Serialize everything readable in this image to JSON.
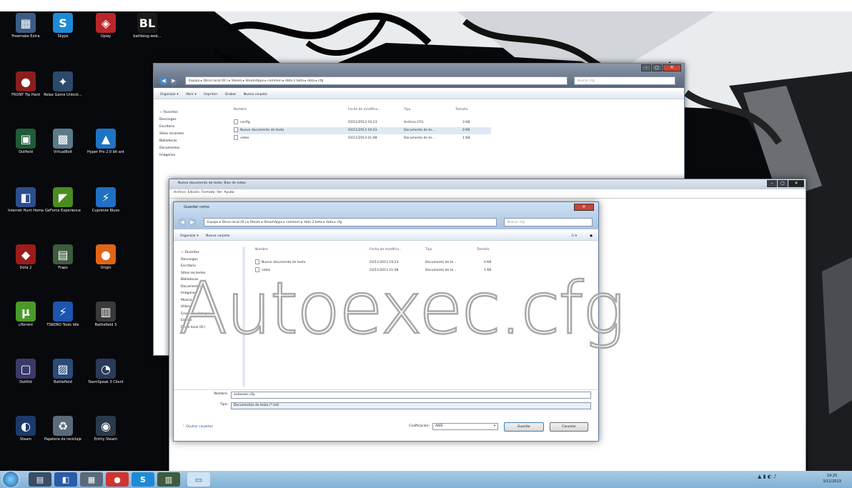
{
  "overlay_text": "Autoexec.cfg",
  "desktop_icons": [
    {
      "label": "Freemake Extra",
      "color": "#3a5d85",
      "glyph": "▦"
    },
    {
      "label": "Skype",
      "color": "#1e8ad6",
      "glyph": "S"
    },
    {
      "label": "Uplay",
      "color": "#b8262a",
      "glyph": "◈"
    },
    {
      "label": "battlelog-web...",
      "color": "#1a1a1a",
      "glyph": "BL"
    },
    {
      "label": "FRONT Tip Hard",
      "color": "#8a1e1e",
      "glyph": "●"
    },
    {
      "label": "Relax Game Unlock...",
      "color": "#2b4a6b",
      "glyph": "✦"
    },
    {
      "label": "Outfield",
      "color": "#1f5c37",
      "glyph": "▣"
    },
    {
      "label": "VirtualBolt",
      "color": "#5a7a8a",
      "glyph": "▩"
    },
    {
      "label": "Hyper Pro 2.0 bit ant",
      "color": "#1e74c4",
      "glyph": "▲"
    },
    {
      "label": "Internet Hunt Home",
      "color": "#2c4f8c",
      "glyph": "◧"
    },
    {
      "label": "GeForce Experience",
      "color": "#4b8b1f",
      "glyph": "◤"
    },
    {
      "label": "Cuprente Blues",
      "color": "#1f6fc2",
      "glyph": "⚡"
    },
    {
      "label": "Dota 2",
      "color": "#9c1c1c",
      "glyph": "◆"
    },
    {
      "label": "Fraps",
      "color": "#3f5a3f",
      "glyph": "▤"
    },
    {
      "label": "Origin",
      "color": "#e06515",
      "glyph": "●"
    },
    {
      "label": "uTorrent",
      "color": "#4a9a2a",
      "glyph": "μ"
    },
    {
      "label": "TSKORO Tools Idle",
      "color": "#1c54b0",
      "glyph": "⚡"
    },
    {
      "label": "Battlefield 3",
      "color": "#3a3a3a",
      "glyph": "▥"
    },
    {
      "label": "DotRtd",
      "color": "#3a3a6a",
      "glyph": "▢"
    },
    {
      "label": "Battlefield",
      "color": "#2a4a7a",
      "glyph": "▨"
    },
    {
      "label": "TeamSpeak 3 Client",
      "color": "#2a3a5a",
      "glyph": "◔"
    },
    {
      "label": "Steam",
      "color": "#1b3a6a",
      "glyph": "◐"
    },
    {
      "label": "Papelera de reciclaje",
      "color": "#5a6a7a",
      "glyph": "♻"
    },
    {
      "label": "Entity Steam",
      "color": "#2a3a4a",
      "glyph": "◉"
    }
  ],
  "explorer_back": {
    "breadcrumb": "Equipo ▸ Disco local (D:) ▸ Steam ▸ SteamApps ▸ common ▸ dota 2 beta ▸ dota ▸ cfg",
    "search_placeholder": "Buscar cfg",
    "toolbar": [
      "Organizar ▾",
      "Abrir ▾",
      "Imprimir",
      "Grabar",
      "Nueva carpeta"
    ],
    "nav": [
      "☆ Favoritos",
      "Descargas",
      "Escritorio",
      "Sitios recientes",
      "",
      "Bibliotecas",
      "Documentos",
      "Imágenes"
    ],
    "columns": [
      "Nombre",
      "Fecha de modifica...",
      "Tipo",
      "Tamaño"
    ],
    "files": [
      {
        "name": "config",
        "date": "03/11/2013 19:23",
        "type": "Archivo CFG",
        "size": "3 KB"
      },
      {
        "name": "Nuevo documento de texto",
        "date": "03/11/2013 19:23",
        "type": "Documento de te...",
        "size": "0 KB"
      },
      {
        "name": "video",
        "date": "03/11/2013 21:08",
        "type": "Documento de te...",
        "size": "1 KB"
      }
    ]
  },
  "notepad": {
    "title": "Nuevo documento de texto: Bloc de notas",
    "menu": "Archivo  Edición  Formato  Ver  Ayuda"
  },
  "save_dialog": {
    "title": "Guardar como",
    "breadcrumb": "Equipo ▸ Disco local (D:) ▸ Steam ▸ SteamApps ▸ common ▸ dota 2 beta ▸ dota ▸ cfg",
    "search_placeholder": "Buscar cfg",
    "toolbar": [
      "Organizar ▾",
      "Nueva carpeta"
    ],
    "nav": [
      "☆ Favoritos",
      "Descargas",
      "Escritorio",
      "Sitios recientes",
      "",
      "Bibliotecas",
      "Documentos",
      "Imágenes",
      "Música",
      "Vídeos",
      "",
      "Grupo en el hogar",
      "",
      "Equipo",
      "Disco local (D:)"
    ],
    "columns": [
      "Nombre",
      "Fecha de modifica...",
      "Tipo",
      "Tamaño"
    ],
    "files": [
      {
        "name": "Nuevo documento de texto",
        "date": "03/11/2013 19:23",
        "type": "Documento de te...",
        "size": "0 KB"
      },
      {
        "name": "video",
        "date": "03/11/2013 21:08",
        "type": "Documento de te...",
        "size": "1 KB"
      }
    ],
    "filename_label": "Nombre:",
    "filename_value": "autoexec.cfg",
    "type_label": "Tipo:",
    "type_value": "Documentos de texto (*.txt)",
    "hide_folders": "Ocultar carpetas",
    "encoding_label": "Codificación:",
    "encoding_value": "ANSI",
    "save_label": "Guardar",
    "cancel_label": "Cancelar"
  },
  "taskbar": {
    "clock_time": "19:25",
    "clock_date": "3/11/2013"
  }
}
